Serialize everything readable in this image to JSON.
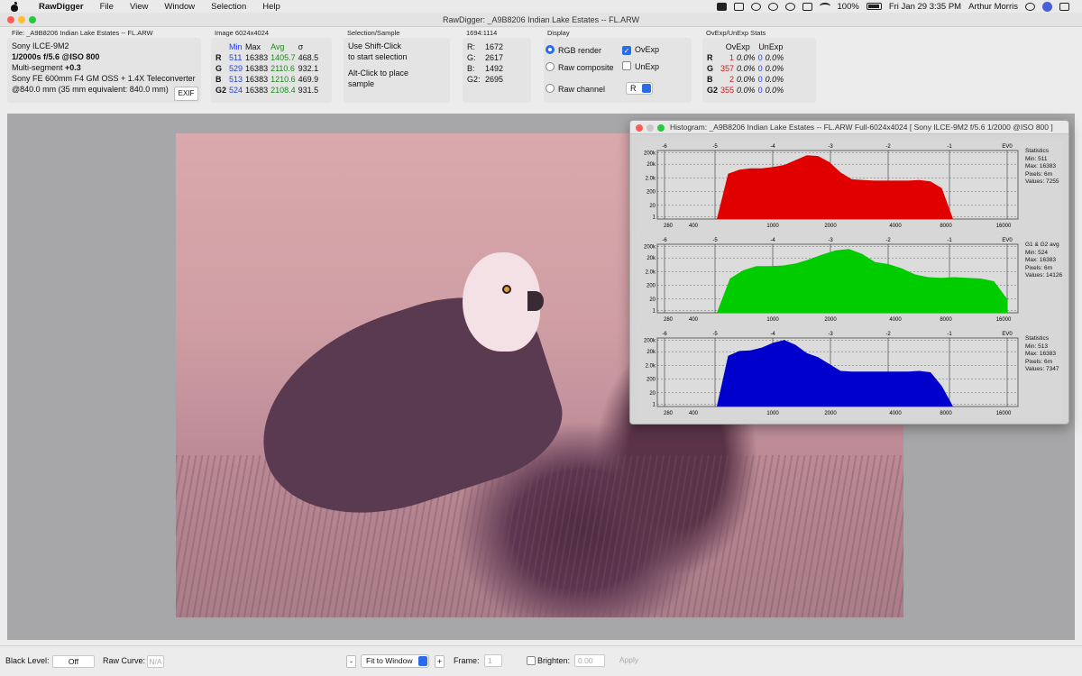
{
  "menubar": {
    "app_name": "RawDigger",
    "menus": [
      "File",
      "View",
      "Window",
      "Selection",
      "Help"
    ],
    "battery": "100%",
    "datetime": "Fri Jan 29  3:35 PM",
    "user": "Arthur Morris"
  },
  "window": {
    "title": "RawDigger: _A9B8206  Indian Lake Estates -- FL.ARW"
  },
  "file_panel": {
    "label": "File: _A9B8206  Indian Lake Estates -- FL.ARW",
    "camera": "Sony ILCE-9M2",
    "exposure": "1/2000s f/5.6 @ISO 800",
    "multisegment_label": "Multi-segment",
    "multisegment_value": "+0.3",
    "lens": "Sony FE 600mm F4 GM OSS + 1.4X Teleconverter",
    "focal": "@840.0 mm (35 mm equivalent: 840.0 mm)",
    "exif_button": "EXIF"
  },
  "image_panel": {
    "label": "Image 6024x4024",
    "headers": [
      "Min",
      "Max",
      "Avg",
      "σ"
    ],
    "rows": [
      {
        "ch": "R",
        "min": "511",
        "max": "16383",
        "avg": "1405.7",
        "sigma": "468.5"
      },
      {
        "ch": "G",
        "min": "529",
        "max": "16383",
        "avg": "2110.6",
        "sigma": "932.1"
      },
      {
        "ch": "B",
        "min": "513",
        "max": "16383",
        "avg": "1210.6",
        "sigma": "469.9"
      },
      {
        "ch": "G2",
        "min": "524",
        "max": "16383",
        "avg": "2108.4",
        "sigma": "931.5"
      }
    ]
  },
  "selection_panel": {
    "label": "Selection/Sample",
    "line1": "Use Shift-Click",
    "line2": "to start selection",
    "line3": "Alt-Click to place",
    "line4": "sample"
  },
  "sample_panel": {
    "label": "1694:1114",
    "rows": [
      {
        "ch": "R:",
        "val": "1672"
      },
      {
        "ch": "G:",
        "val": "2617"
      },
      {
        "ch": "B:",
        "val": "1492"
      },
      {
        "ch": "G2:",
        "val": "2695"
      }
    ]
  },
  "display_panel": {
    "label": "Display",
    "rgb_render": "RGB render",
    "raw_composite": "Raw composite",
    "raw_channel": "Raw channel",
    "ovexp": "OvExp",
    "unexp": "UnExp",
    "channel_select": "R"
  },
  "ovexp_panel": {
    "label": "OvExp/UnExp Stats",
    "headers": [
      "OvExp",
      "UnExp"
    ],
    "rows": [
      {
        "ch": "R",
        "ov": "1",
        "ovp": "0.0%",
        "un": "0",
        "unp": "0.0%"
      },
      {
        "ch": "G",
        "ov": "357",
        "ovp": "0.0%",
        "un": "0",
        "unp": "0.0%"
      },
      {
        "ch": "B",
        "ov": "2",
        "ovp": "0.0%",
        "un": "0",
        "unp": "0.0%"
      },
      {
        "ch": "G2",
        "ov": "355",
        "ovp": "0.0%",
        "un": "0",
        "unp": "0.0%"
      }
    ]
  },
  "histogram": {
    "title": "Histogram: _A9B8206  Indian Lake Estates -- FL.ARW Full-6024x4024 [ Sony ILCE-9M2 f/5.6 1/2000 @ISO 800 ]",
    "ev_ticks": [
      "-6",
      "-5",
      "-4",
      "-3",
      "-2",
      "-1",
      "EV0"
    ],
    "y_ticks": [
      "200k",
      "20k",
      "2.0k",
      "200",
      "20",
      "1"
    ],
    "x_ticks": [
      "280",
      "400",
      "1000",
      "2000",
      "4000",
      "8000",
      "16000"
    ],
    "panels": [
      {
        "color": "#e00000",
        "stats": [
          "Statistics",
          "Min: 511",
          "Max: 16383",
          "Pixels: 6m",
          "Values: 7255"
        ],
        "profile": [
          0.0,
          0.66,
          0.72,
          0.74,
          0.74,
          0.76,
          0.79,
          0.86,
          0.93,
          0.92,
          0.83,
          0.68,
          0.58,
          0.57,
          0.56,
          0.56,
          0.56,
          0.56,
          0.57,
          0.55,
          0.45,
          0.0
        ]
      },
      {
        "color": "#00cc00",
        "stats": [
          "G1 & G2 avg",
          "Min: 524",
          "Max: 16383",
          "Pixels: 6m",
          "Values: 14126"
        ],
        "profile": [
          0.0,
          0.5,
          0.62,
          0.68,
          0.68,
          0.69,
          0.72,
          0.78,
          0.85,
          0.91,
          0.93,
          0.86,
          0.74,
          0.71,
          0.65,
          0.56,
          0.52,
          0.51,
          0.52,
          0.51,
          0.5,
          0.46,
          0.2
        ]
      },
      {
        "color": "#0000cc",
        "stats": [
          "Statistics",
          "Min: 513",
          "Max: 16383",
          "Pixels: 6m",
          "Values: 7347"
        ],
        "profile": [
          0.0,
          0.74,
          0.81,
          0.82,
          0.86,
          0.93,
          0.97,
          0.9,
          0.78,
          0.72,
          0.62,
          0.52,
          0.51,
          0.51,
          0.51,
          0.51,
          0.51,
          0.51,
          0.52,
          0.5,
          0.3,
          0.0
        ]
      }
    ]
  },
  "bottombar": {
    "black_level_label": "Black Level:",
    "black_level_value": "Off",
    "raw_curve_label": "Raw Curve:",
    "raw_curve_value": "N/A",
    "minus": "-",
    "zoom": "Fit to Window",
    "plus": "+",
    "frame_label": "Frame:",
    "frame_value": "1",
    "brighten_label": "Brighten:",
    "brighten_value": "0.00",
    "apply": "Apply"
  }
}
